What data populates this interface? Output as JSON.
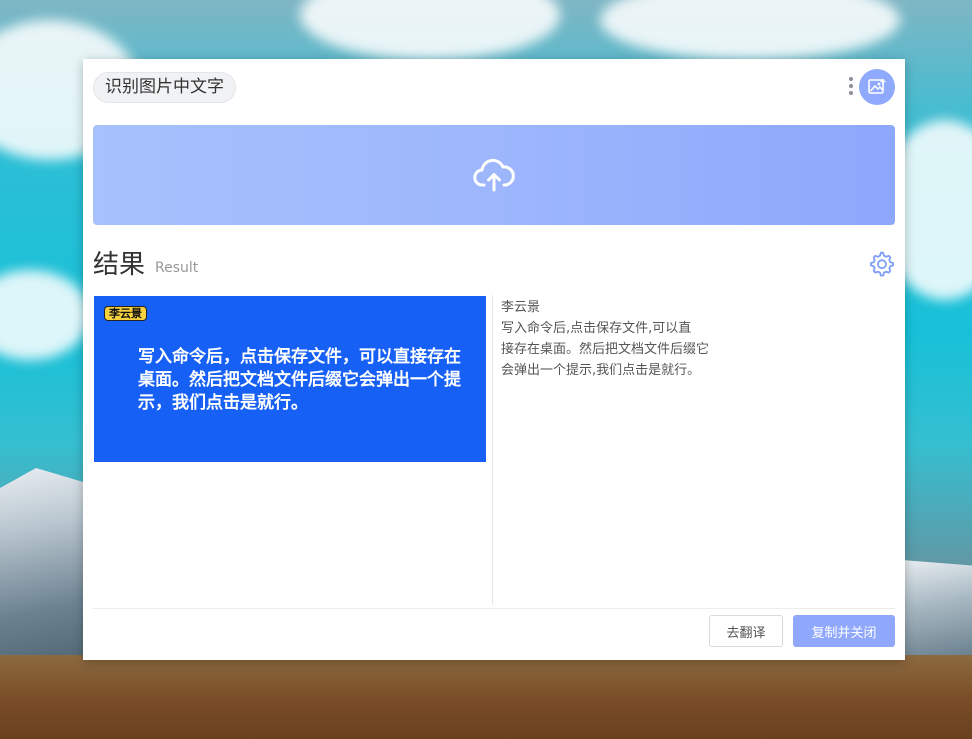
{
  "header": {
    "title": "识别图片中文字",
    "more_icon": "more-vertical-icon",
    "image_icon": "image-add-icon",
    "accent_color": "#8faafc"
  },
  "upload": {
    "icon": "cloud-upload-icon",
    "gradient": [
      "#a7c1fd",
      "#8da8fb"
    ]
  },
  "result": {
    "title": "结果",
    "subtitle": "Result",
    "settings_icon": "gear-icon"
  },
  "preview": {
    "tag": "李云景",
    "text": "写入命令后，点击保存文件，可以直接存在桌面。然后把文档文件后缀它会弹出一个提示，我们点击是就行。",
    "background_color": "#1660f5",
    "tag_color": "#f7d13e"
  },
  "ocr": {
    "lines": [
      "李云景",
      "写入命令后,点击保存文件,可以直",
      "接存在桌面。然后把文档文件后缀它",
      "会弹出一个提示,我们点击是就行。"
    ]
  },
  "footer": {
    "translate_label": "去翻译",
    "copy_close_label": "复制并关闭"
  }
}
